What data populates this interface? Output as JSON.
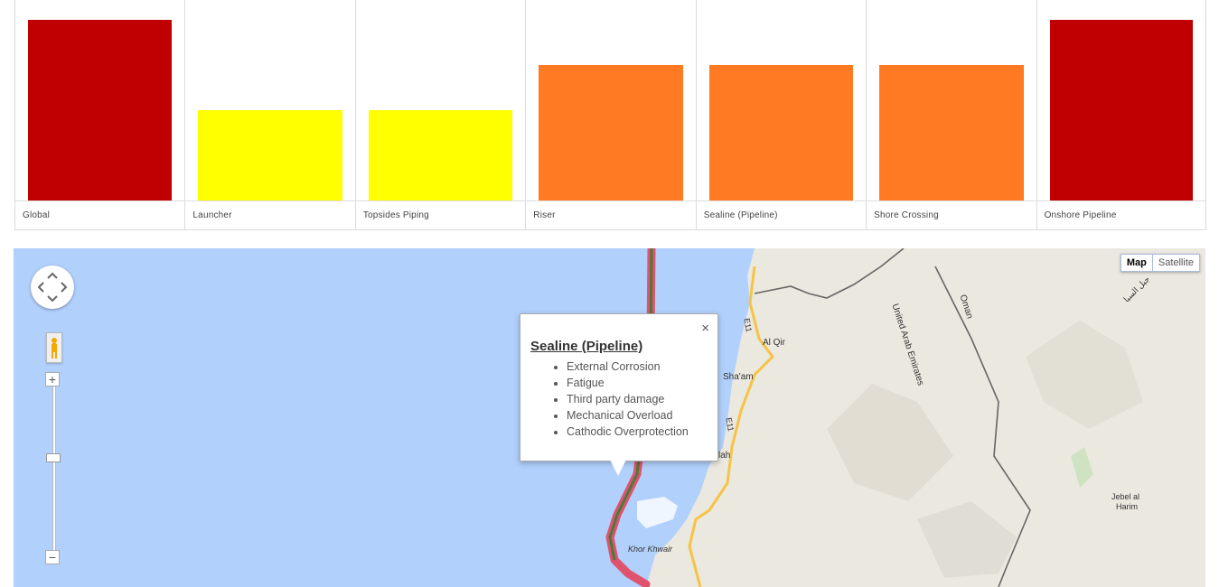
{
  "chart_data": {
    "type": "bar",
    "categories": [
      "Global",
      "Launcher",
      "Topsides Piping",
      "Riser",
      "Sealine (Pipeline)",
      "Shore Crossing",
      "Onshore Pipeline"
    ],
    "values": [
      4,
      2,
      2,
      3,
      3,
      3,
      4
    ],
    "colors": [
      "#c00000",
      "#ffff00",
      "#ffff00",
      "#ff7a22",
      "#ff7a22",
      "#ff7a22",
      "#c00000"
    ],
    "ylim": [
      0,
      4
    ]
  },
  "map": {
    "map_type_buttons": [
      "Map",
      "Satellite"
    ],
    "zoom_in_label": "+",
    "zoom_out_label": "−",
    "zoom_level": 0.3,
    "colors": {
      "water": "#b1d0fc",
      "land": "#ebe8e0",
      "pipeline_outer": "#e0536e",
      "pipeline_inner": "#4a7a3a",
      "road": "#f6c445"
    },
    "labels": {
      "al_qir": "Al Qir",
      "shaam": "Sha'am",
      "uae": "United Arab Emirates",
      "oman": "Oman",
      "e11_a": "E11",
      "e11_b": "E11",
      "lah": "lah",
      "khor_khwair": "Khor Khwair",
      "jebel": "Jebel al",
      "harim": "Harim",
      "arabic": "جبل السبا"
    }
  },
  "infowindow": {
    "title": "Sealine (Pipeline)",
    "close_label": "×",
    "items": [
      "External Corrosion",
      "Fatigue",
      "Third party damage",
      "Mechanical Overload",
      "Cathodic Overprotection"
    ]
  }
}
